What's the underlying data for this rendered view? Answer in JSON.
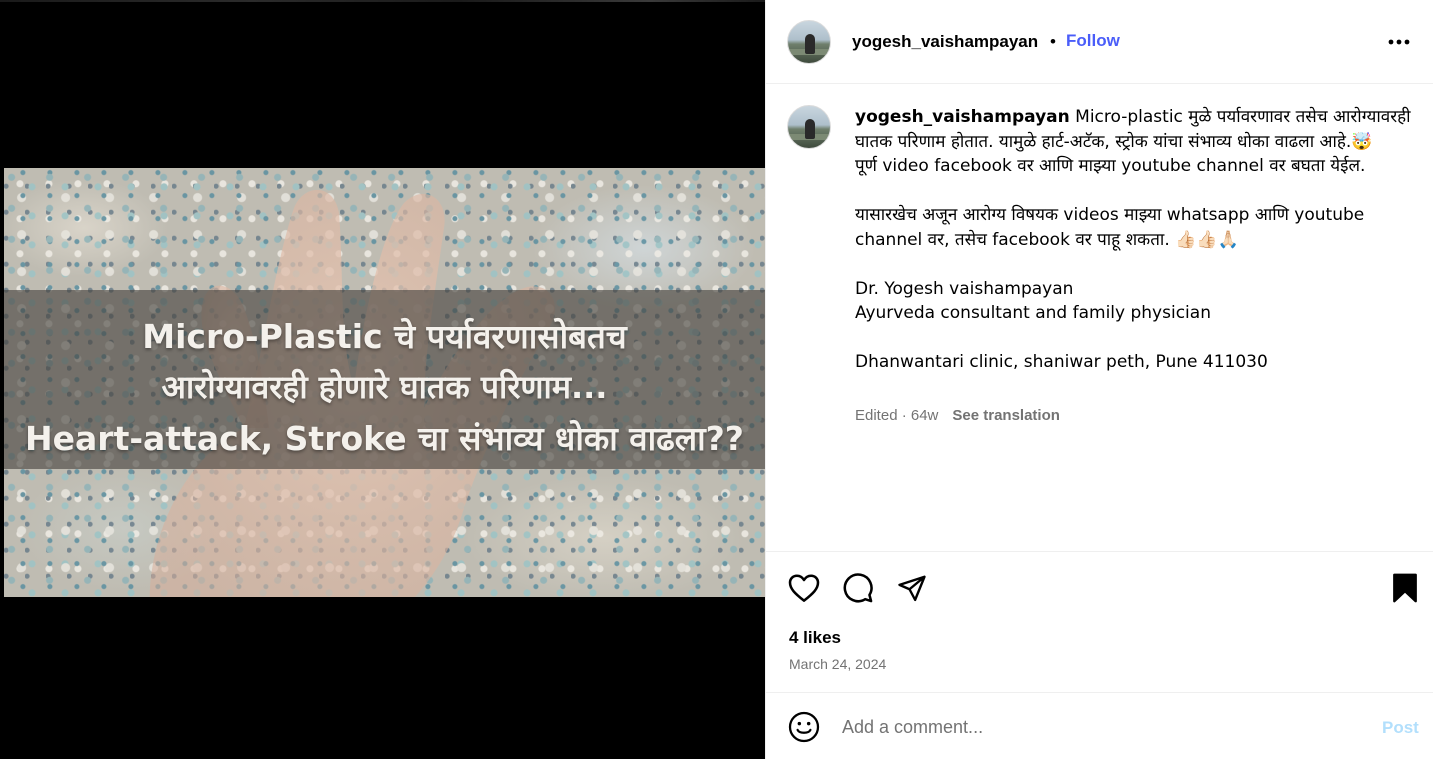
{
  "media": {
    "banner_lines": [
      "Micro-Plastic चे पर्यावरणासोबतच",
      "आरोग्यावरही होणारे घातक परिणाम...",
      "Heart-attack, Stroke चा संभाव्य धोका वाढला??"
    ]
  },
  "header": {
    "username": "yogesh_vaishampayan",
    "separator": "•",
    "follow_label": "Follow",
    "more_icon": "more-horizontal-icon"
  },
  "caption": {
    "username": "yogesh_vaishampayan",
    "paragraphs": [
      "Micro-plastic मुळे पर्यावरणावर तसेच आरोग्यावरही घातक परिणाम होतात. यामुळे हार्ट-अटॅक, स्ट्रोक यांचा संभाव्य धोका वाढला आहे.🤯\nपूर्ण video facebook वर आणि माझ्या youtube channel वर बघता येईल.",
      "यासारखेच अजून आरोग्य विषयक videos माझ्या whatsapp आणि youtube channel वर, तसेच facebook वर पाहू शकता. 👍🏻👍🏻🙏🏻",
      "Dr. Yogesh vaishampayan\nAyurveda consultant and family physician",
      "Dhanwantari clinic, shaniwar peth, Pune 411030"
    ],
    "meta": "Edited · 64w",
    "see_translation": "See translation"
  },
  "actions": {
    "like_icon": "heart-icon",
    "comment_icon": "comment-icon",
    "share_icon": "share-icon",
    "save_icon": "bookmark-icon"
  },
  "likes": "4 likes",
  "date": "March 24, 2024",
  "comment_box": {
    "emoji_icon": "emoji-icon",
    "placeholder": "Add a comment...",
    "post_label": "Post"
  },
  "colors": {
    "follow": "#4a5df9",
    "muted": "#737373",
    "post_disabled": "#b2dffc",
    "border": "#efefef"
  }
}
